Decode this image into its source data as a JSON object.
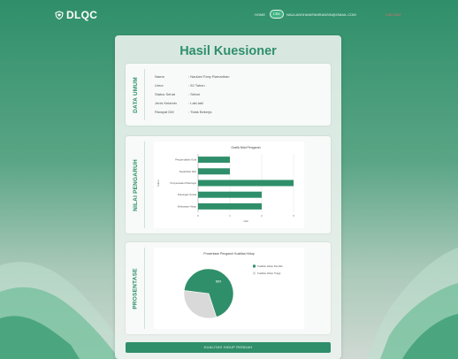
{
  "colors": {
    "brand": "#2f8f6a",
    "accent": "#43b483",
    "danger": "#f26b6b",
    "pie_secondary": "#d9d9d9"
  },
  "navbar": {
    "logo_text": "DLQC",
    "links": [
      {
        "label": "HOME",
        "active": false
      },
      {
        "label": "CEK",
        "active": true
      },
      {
        "label": "NAULANSHANIFAMRANSIN@GMAIL.COM",
        "active": false
      },
      {
        "label": "LOG OUT",
        "active": false
      }
    ]
  },
  "card": {
    "title": "Hasil Kuesioner"
  },
  "data_umum": {
    "label": "DATA UMUM",
    "rows": [
      {
        "key": "Nama",
        "value": ": Naulani Fany Ramadhan"
      },
      {
        "key": "Umur",
        "value": ": 52 Tahun"
      },
      {
        "key": "Status Sehat",
        "value": ": Sehat"
      },
      {
        "key": "Jenis Kelamin",
        "value": ": Laki-laki"
      },
      {
        "key": "Riwayat DM",
        "value": ": Tidak Bekerja"
      }
    ]
  },
  "nilai_pengaruh": {
    "label": "NILAI PENGARUH"
  },
  "prosentase": {
    "label": "PROSENTASE"
  },
  "chart_data": [
    {
      "type": "bar",
      "orientation": "horizontal",
      "title": "Grafik Nilai Pengaruh",
      "xlabel": "nilai",
      "ylabel": "faktor",
      "categories": [
        "Pengendalian Gula",
        "Kepatuhan Diet",
        "Penyesuaian Psikologis",
        "Dukungan Sosial",
        "Kebiasaan Hidup"
      ],
      "values": [
        1,
        1,
        3,
        2,
        2
      ],
      "xlim": [
        0,
        3
      ],
      "grid": true,
      "legend": "none"
    },
    {
      "type": "pie",
      "title": "Prosentase Pengaruh Kualitas Hidup",
      "series": [
        {
          "name": "Kualitas Hidup Rendah",
          "value": 68.0,
          "color": "#2f8f6a"
        },
        {
          "name": "Kualitas Hidup Tinggi",
          "value": 32.0,
          "color": "#d9d9d9"
        }
      ],
      "slice_label": "68%",
      "legend": "right"
    }
  ],
  "bottom_button": {
    "label": "KUALITAS HIDUP RENDAH"
  }
}
